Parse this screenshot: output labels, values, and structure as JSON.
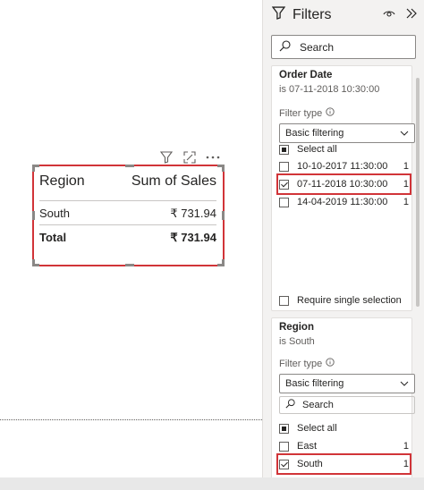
{
  "table_visual": {
    "col_region": "Region",
    "col_sales": "Sum of Sales",
    "rows": [
      {
        "region": "South",
        "sales": "₹ 731.94"
      }
    ],
    "total_label": "Total",
    "total_value": "₹ 731.94"
  },
  "filters_pane": {
    "title": "Filters",
    "search_placeholder": "Search",
    "order_date": {
      "title": "Order Date",
      "summary": "is 07-11-2018 10:30:00",
      "filter_type_label": "Filter type",
      "filter_type_value": "Basic filtering",
      "select_all": "Select all",
      "options": [
        {
          "label": "10-10-2017 11:30:00",
          "count": "1",
          "checked": false
        },
        {
          "label": "07-11-2018 10:30:00",
          "count": "1",
          "checked": true
        },
        {
          "label": "14-04-2019 11:30:00",
          "count": "1",
          "checked": false
        }
      ],
      "require_single": "Require single selection"
    },
    "region": {
      "title": "Region",
      "summary": "is South",
      "filter_type_label": "Filter type",
      "filter_type_value": "Basic filtering",
      "search_placeholder": "Search",
      "select_all": "Select all",
      "options": [
        {
          "label": "East",
          "count": "1",
          "checked": false
        },
        {
          "label": "South",
          "count": "1",
          "checked": true
        }
      ]
    }
  },
  "colors": {
    "highlight": "#d13438",
    "pane_bg": "#f3f2f1"
  }
}
